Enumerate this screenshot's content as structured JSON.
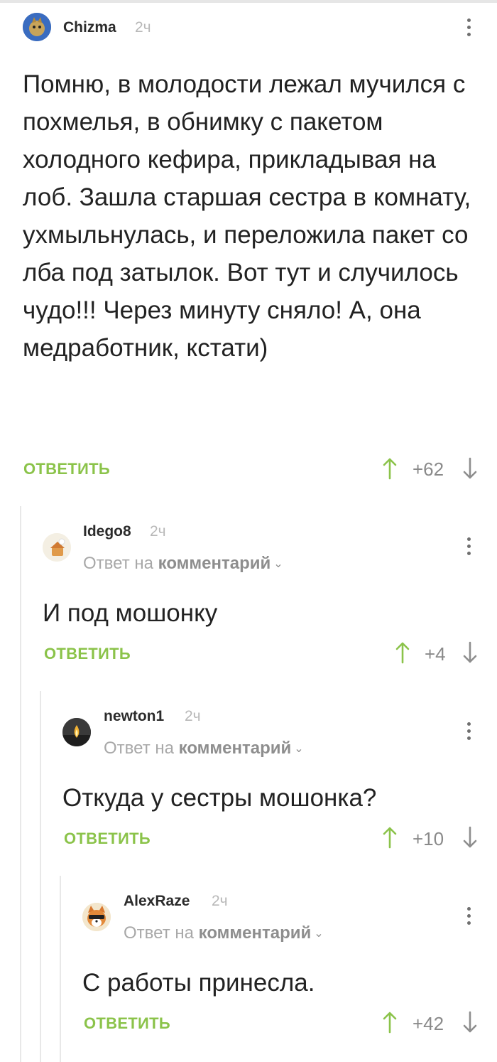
{
  "comments": [
    {
      "username": "Chizma",
      "time": "2ч",
      "text": "Помню, в молодости лежал мучился с похмелья, в обнимку с пакетом холодного кефира, прикладывая на лоб. Зашла старшая сестра в комнату, ухмыльнулась, и переложила пакет со лба под затылок. Вот тут и случилось чудо!!! Через минуту сняло! А, она медработник, кстати)",
      "reply_label": "ОТВЕТИТЬ",
      "score": "+62"
    },
    {
      "username": "Idego8",
      "time": "2ч",
      "reply_prefix": "Ответ на",
      "reply_target": "комментарий",
      "text": "И под мошонку",
      "reply_label": "ОТВЕТИТЬ",
      "score": "+4"
    },
    {
      "username": "newton1",
      "time": "2ч",
      "reply_prefix": "Ответ на",
      "reply_target": "комментарий",
      "text": "Откуда у сестры мошонка?",
      "reply_label": "ОТВЕТИТЬ",
      "score": "+10"
    },
    {
      "username": "AlexRaze",
      "time": "2ч",
      "reply_prefix": "Ответ на",
      "reply_target": "комментарий",
      "text": "С работы принесла.",
      "reply_label": "ОТВЕТИТЬ",
      "score": "+42"
    }
  ],
  "colors": {
    "accent_green": "#8bc34a",
    "text": "#222222",
    "muted": "#a8a8a8",
    "thread_line": "#e8e8e8"
  },
  "icons": {
    "menu": "more-vertical-icon",
    "upvote": "arrow-up-icon",
    "downvote": "arrow-down-icon",
    "reply_chevron": "chevron-down-icon"
  }
}
